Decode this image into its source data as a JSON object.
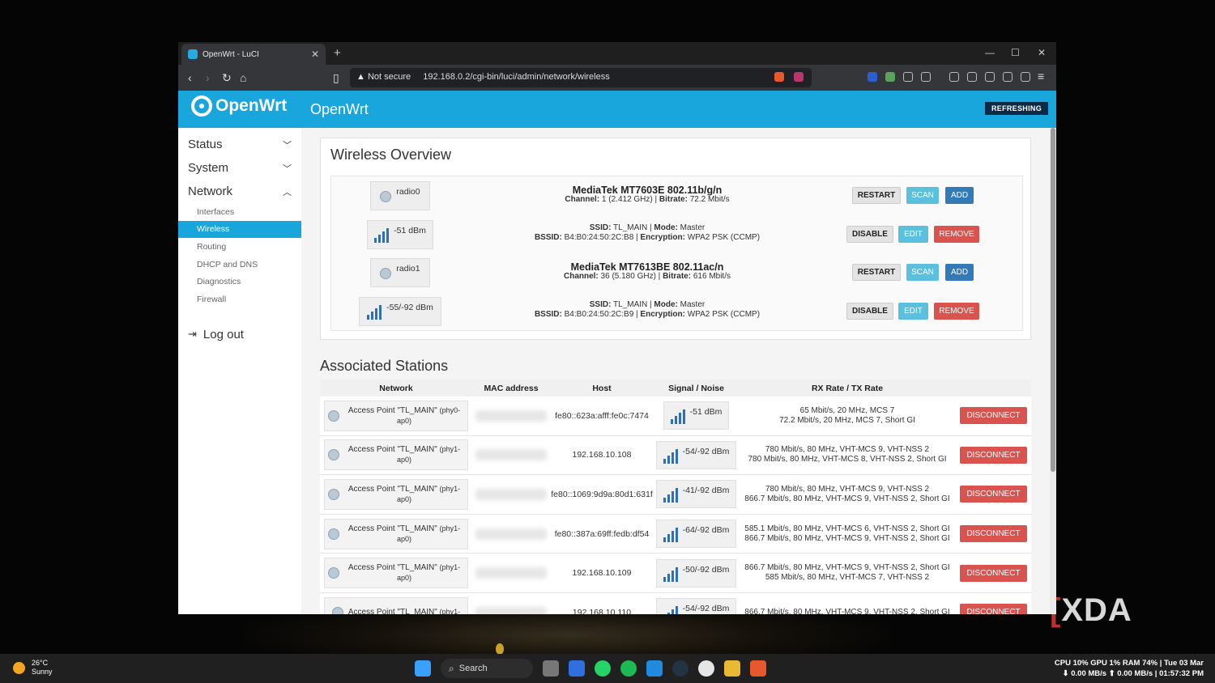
{
  "browser": {
    "tab_title": "OpenWrt - LuCI",
    "new_tab": "+",
    "not_secure": "Not secure",
    "url": "192.168.0.2/cgi-bin/luci/admin/network/wireless"
  },
  "luci": {
    "brand": "OpenWrt",
    "logo_text": "OpenWrt",
    "refreshing": "REFRESHING"
  },
  "sidebar": {
    "items": [
      {
        "label": "Status"
      },
      {
        "label": "System"
      },
      {
        "label": "Network"
      }
    ],
    "network_subitems": [
      "Interfaces",
      "Wireless",
      "Routing",
      "DHCP and DNS",
      "Diagnostics",
      "Firewall"
    ],
    "active_sub": "Wireless",
    "logout": "Log out"
  },
  "overview": {
    "title": "Wireless Overview",
    "devices": [
      {
        "radio_badge": "radio0",
        "title": "MediaTek MT7603E 802.11b/g/n",
        "sub_label1": "Channel:",
        "sub_val1": " 1 (2.412 GHz) | ",
        "sub_label2": "Bitrate:",
        "sub_val2": " 72.2 Mbit/s",
        "buttons": [
          "RESTART",
          "SCAN",
          "ADD"
        ],
        "iface": {
          "signal": "-51 dBm",
          "ssid_label": "SSID:",
          "ssid": " TL_MAIN | ",
          "mode_label": "Mode:",
          "mode": " Master",
          "bssid_label": "BSSID:",
          "bssid": " B4:B0:24:50:2C:B8 | ",
          "enc_label": "Encryption:",
          "enc": " WPA2 PSK (CCMP)",
          "buttons": [
            "DISABLE",
            "EDIT",
            "REMOVE"
          ]
        }
      },
      {
        "radio_badge": "radio1",
        "title": "MediaTek MT7613BE 802.11ac/n",
        "sub_label1": "Channel:",
        "sub_val1": " 36 (5.180 GHz) | ",
        "sub_label2": "Bitrate:",
        "sub_val2": " 616 Mbit/s",
        "buttons": [
          "RESTART",
          "SCAN",
          "ADD"
        ],
        "iface": {
          "signal": "-55/-92 dBm",
          "ssid_label": "SSID:",
          "ssid": " TL_MAIN | ",
          "mode_label": "Mode:",
          "mode": " Master",
          "bssid_label": "BSSID:",
          "bssid": " B4:B0:24:50:2C:B9 | ",
          "enc_label": "Encryption:",
          "enc": " WPA2 PSK (CCMP)",
          "buttons": [
            "DISABLE",
            "EDIT",
            "REMOVE"
          ]
        }
      }
    ]
  },
  "stations": {
    "title": "Associated Stations",
    "headers": [
      "Network",
      "MAC address",
      "Host",
      "Signal / Noise",
      "RX Rate / TX Rate"
    ],
    "rows": [
      {
        "net": "Access Point \"TL_MAIN\"",
        "phy": "(phy0-ap0)",
        "host": "fe80::623a:afff:fe0c:7474",
        "signal": "-51 dBm",
        "rx": "65 Mbit/s, 20 MHz, MCS 7",
        "tx": "72.2 Mbit/s, 20 MHz, MCS 7, Short GI",
        "btn": "DISCONNECT"
      },
      {
        "net": "Access Point \"TL_MAIN\"",
        "phy": "(phy1-ap0)",
        "host": "192.168.10.108",
        "signal": "-54/-92 dBm",
        "rx": "780 Mbit/s, 80 MHz, VHT-MCS 9, VHT-NSS 2",
        "tx": "780 Mbit/s, 80 MHz, VHT-MCS 8, VHT-NSS 2, Short GI",
        "btn": "DISCONNECT"
      },
      {
        "net": "Access Point \"TL_MAIN\"",
        "phy": "(phy1-ap0)",
        "host": "fe80::1069:9d9a:80d1:631f",
        "signal": "-41/-92 dBm",
        "rx": "780 Mbit/s, 80 MHz, VHT-MCS 9, VHT-NSS 2",
        "tx": "866.7 Mbit/s, 80 MHz, VHT-MCS 9, VHT-NSS 2, Short GI",
        "btn": "DISCONNECT"
      },
      {
        "net": "Access Point \"TL_MAIN\"",
        "phy": "(phy1-ap0)",
        "host": "fe80::387a:69ff:fedb:df54",
        "signal": "-64/-92 dBm",
        "rx": "585.1 Mbit/s, 80 MHz, VHT-MCS 6, VHT-NSS 2, Short GI",
        "tx": "866.7 Mbit/s, 80 MHz, VHT-MCS 9, VHT-NSS 2, Short GI",
        "btn": "DISCONNECT"
      },
      {
        "net": "Access Point \"TL_MAIN\"",
        "phy": "(phy1-ap0)",
        "host": "192.168.10.109",
        "signal": "-50/-92 dBm",
        "rx": "866.7 Mbit/s, 80 MHz, VHT-MCS 9, VHT-NSS 2, Short GI",
        "tx": "585 Mbit/s, 80 MHz, VHT-MCS 7, VHT-NSS 2",
        "btn": "DISCONNECT"
      },
      {
        "net": "Access Point \"TL_MAIN\"",
        "phy": "(phy1-",
        "host": "192.168.10.110",
        "signal": "-54/-92 dBm",
        "rx": "866.7 Mbit/s, 80 MHz, VHT-MCS 9, VHT-NSS 2, Short GI",
        "tx": "",
        "btn": "DISCONNECT"
      }
    ]
  },
  "watermark": "XDA",
  "taskbar": {
    "temp": "26°C",
    "weather": "Sunny",
    "search": "Search",
    "stats_line1": "CPU 10% GPU   1% RAM 74% | Tue 03 Mar",
    "stats_line2": "⬇ 0.00 MB/s ⬆ 0.00 MB/s | 01:57:32 PM"
  },
  "colors": {
    "accent": "#18a6dd",
    "danger": "#d9534f",
    "info": "#5bc0de",
    "primary": "#337ab7",
    "badge_dark": "#0b2a47"
  }
}
